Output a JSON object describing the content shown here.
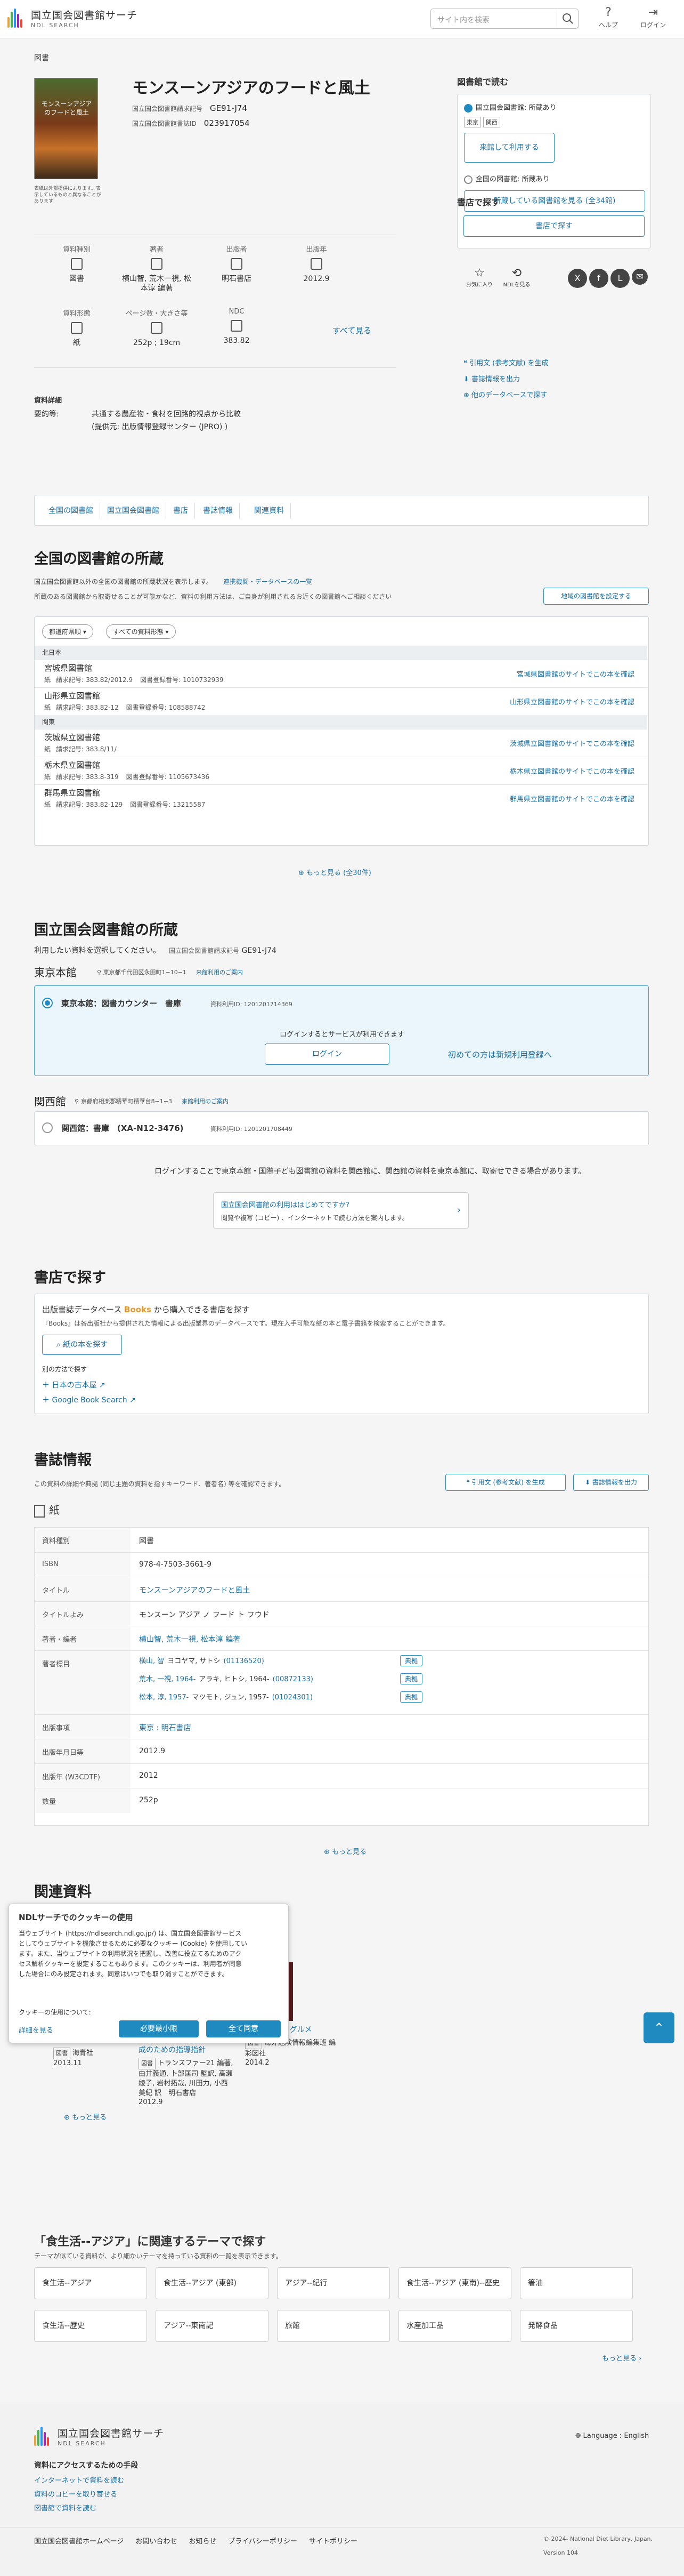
{
  "header": {
    "logo_title": "国立国会図書館サーチ",
    "logo_sub": "NDL SEARCH",
    "search_placeholder": "サイト内を検索",
    "help": "ヘルプ",
    "login": "ログイン"
  },
  "breadcrumb": "図書",
  "book": {
    "title": "モンスーンアジアのフードと風土",
    "cover_note": "表紙は外部提供によります。表示しているものと異なることがあります",
    "id_label1": "国立国会図書館請求記号",
    "id_val1": "GE91-J74",
    "id_label2": "国立国会図書館書誌ID",
    "id_val2": "023917054"
  },
  "facts": [
    {
      "label": "資料種別",
      "value": "図書",
      "icon": "book-icon"
    },
    {
      "label": "著者",
      "value": "横山智, 荒木一視, 松本淳 編著",
      "icon": "pen-icon"
    },
    {
      "label": "出版者",
      "value": "明石書店",
      "icon": "building-icon"
    },
    {
      "label": "出版年",
      "value": "2012.9",
      "icon": "calendar-icon"
    },
    {
      "label": "資料形態",
      "value": "紙",
      "icon": "paper-icon"
    },
    {
      "label": "ページ数・大きさ等",
      "value": "252p ; 19cm",
      "icon": "ruler-icon"
    },
    {
      "label": "NDC",
      "value": "383.82",
      "icon": "tree-icon"
    }
  ],
  "see_all": "すべて見る",
  "details": {
    "heading": "資料詳細",
    "summary_label": "要約等:",
    "summary": "共通する農産物・食材を回路的視点から比較",
    "summary2": "(提供元: 出版情報登録センター (JPRO) )"
  },
  "side": {
    "read_title": "図書館で読む",
    "ndl_label": "国立国会図書館: 所蔵あり",
    "tags": [
      "東京",
      "関西"
    ],
    "ndl_btn": "来館して利用する",
    "pref_label": "全国の図書館: 所蔵あり",
    "pref_btn": "所蔵している図書館を見る (全34館)",
    "buy_title": "書店で探す",
    "buy_btn": "書店で探す",
    "favorite": "お気に入り",
    "ndl_recommend": "NDLを見る",
    "cite": "引用文 (参考文献) を生成",
    "bib_out": "書誌情報を出力",
    "other_db": "他のデータベースで探す"
  },
  "tabs": [
    "全国の図書館",
    "国立国会図書館",
    "書店",
    "書誌情報",
    "関連資料"
  ],
  "national": {
    "title": "全国の図書館の所蔵",
    "desc": "国立国会図書館以外の全国の図書館の所蔵状況を表示します。",
    "desc_link": "連携機関・データベースの一覧",
    "note": "所蔵のある図書館から取寄せることが可能かなど、資料の利用方法は、ご自身が利用されるお近くの図書館へご相談ください",
    "set_btn": "地域の図書館を設定する",
    "filter1": "都道府県順",
    "filter2": "すべての資料形態",
    "libs": [
      {
        "region": "北日本",
        "name": "宮城県図書館",
        "call": "383.82/2012.9",
        "regno": "1010732939",
        "link": "宮城県図書館のサイトでこの本を確認"
      },
      {
        "region": "",
        "name": "山形県立図書館",
        "call": "383.82-12",
        "regno": "108588742",
        "link": "山形県立図書館のサイトでこの本を確認"
      },
      {
        "region": "関東",
        "name": "茨城県立図書館",
        "call": "383.8/11/",
        "regno": "",
        "link": "茨城県立図書館のサイトでこの本を確認"
      },
      {
        "region": "",
        "name": "栃木県立図書館",
        "call": "383.8-319",
        "regno": "1105673436",
        "link": "栃木県立図書館のサイトでこの本を確認"
      },
      {
        "region": "",
        "name": "群馬県立図書館",
        "call": "383.82-129",
        "regno": "13215587",
        "link": "群馬県立図書館のサイトでこの本を確認"
      }
    ],
    "call_label": "請求記号:",
    "regno_label": "図書登録番号:",
    "paper": "紙",
    "more": "もっと見る (全30件)"
  },
  "ndl": {
    "title": "国立国会図書館の所蔵",
    "desc": "利用したい資料を選択してください。",
    "callno_label": "国立国会図書館請求記号",
    "callno": "GE91-J74",
    "tokyo": "東京本館",
    "tokyo_addr": "東京都千代田区永田町1−10−1",
    "tokyo_guide": "来館利用のご案内",
    "tokyo_item": "東京本館：図書カウンター　書庫",
    "tokyo_itemid": "資料利用ID: 1201201714369",
    "login_msg": "ログインするとサービスが利用できます",
    "login_btn": "ログイン",
    "register": "初めての方は新規利用登録へ",
    "kansai": "関西館",
    "kansai_addr": "京都府相楽郡精華町精華台8−1−3",
    "kansai_guide": "来館利用のご案内",
    "kansai_item": "関西館：書庫　(XA-N12-3476)",
    "kansai_itemid": "資料利用ID: 1201201708449",
    "transfer_note": "ログインすることで東京本館・国際子ども図書館の資料を関西館に、関西館の資料を東京本館に、取寄せできる場合があります。",
    "help_title": "国立国会図書館の利用ははじめてですか?",
    "help_sub": "閲覧や複写 (コピー) 、インターネットで読む方法を案内します。"
  },
  "shop": {
    "title": "書店で探す",
    "db_prefix": "出版書誌データベース",
    "db_brand": "Books",
    "db_suffix": "から購入できる書店を探す",
    "db_note": "『Books』は各出版社から提供された情報による出版業界のデータベースです。現在入手可能な紙の本と電子書籍を検索することができます。",
    "btn": "紙の本を探す",
    "other": "別の方法で探す",
    "links": [
      "日本の古本屋",
      "Google Book Search"
    ]
  },
  "bib": {
    "title": "書誌情報",
    "desc": "この資料の詳細や典拠 (同じ主題の資料を指すキーワード、著者名) 等を確認できます。",
    "cite": "引用文 (参考文献) を生成",
    "out": "書誌情報を出力",
    "type": "紙",
    "rows": [
      {
        "k": "資料種別",
        "v": "図書"
      },
      {
        "k": "ISBN",
        "v": "978-4-7503-3661-9"
      },
      {
        "k": "タイトル",
        "v": "モンスーンアジアのフードと風土"
      },
      {
        "k": "タイトルよみ",
        "v": "モンスーン アジア ノ フード ト フウド"
      },
      {
        "k": "著者・編者",
        "v": "横山智, 荒木一視, 松本淳 編著"
      }
    ],
    "authority_label": "著者標目",
    "authors": [
      {
        "name": "横山, 智",
        "yomi": "ヨコヤマ, サトシ",
        "id": "01136520"
      },
      {
        "name": "荒木, 一視, 1964-",
        "yomi": "アラキ, ヒトシ, 1964-",
        "id": "00872133"
      },
      {
        "name": "松本, 淳, 1957-",
        "yomi": "マツモト, ジュン, 1957-",
        "id": "01024301"
      }
    ],
    "auth_btn": "典拠",
    "rows2": [
      {
        "k": "出版事項",
        "v": "東京 : 明石書店"
      },
      {
        "k": "出版年月日等",
        "v": "2012.9"
      },
      {
        "k": "出版年 (W3CDTF)",
        "v": "2012"
      },
      {
        "k": "数量",
        "v": "252p"
      }
    ],
    "more": "もっと見る"
  },
  "related": {
    "title": "関連資料",
    "items": [
      {
        "title": "ネイチャー・アンド・ソサエティ研究 第4巻",
        "pub": "海青社",
        "date": "2013.11",
        "tag": "図書"
      },
      {
        "title": "ESDコンピテンシー : 学校の質的向上と形成能力の育成のための指導指針",
        "pub": "トランスファー21 編著, 由井義通, 卜部匡司 監訳, 高瀬綾子, 岩村拓哉, 川田力, 小西美紀 訳　明石書店",
        "date": "2012.9",
        "tag": "図書"
      },
      {
        "title": "海外ブラックグルメ",
        "pub": "海外危険情報編集班 編　彩図社",
        "date": "2014.2",
        "tag": "図書"
      }
    ],
    "more": "もっと見る"
  },
  "cookie": {
    "title": "NDLサーチでのクッキーの使用",
    "body": "当ウェブサイト (https://ndlsearch.ndl.go.jp/) は、国立国会図書館サービスとしてウェブサイトを機能させるために必要なクッキー (Cookie) を使用しています。また、当ウェブサイトの利用状況を把握し、改善に役立てるためのアクセス解析クッキーを設定することもあります。このクッキーは、利用者が同意した場合にのみ設定されます。同意はいつでも取り消すことができます。",
    "q": "クッキーの使用について:",
    "detail": "詳細を見る",
    "reject": "必要最小限",
    "accept": "全て同意"
  },
  "themes": {
    "title": "「食生活--アジア」に関連するテーマで探す",
    "note": "テーマが似ている資料が、より細かいテーマを持っている資料の一覧を表示できます。",
    "items": [
      "食生活--アジア",
      "食生活--アジア (東部)",
      "アジア--紀行",
      "食生活--アジア (東南)--歴史",
      "箸油",
      "食生活--歴史",
      "アジア--東南記",
      "旅館",
      "水産加工品",
      "発酵食品"
    ],
    "more": "もっと見る"
  },
  "footer": {
    "logo_title": "国立国会図書館サーチ",
    "logo_sub": "NDL SEARCH",
    "lang": "Language : English",
    "access_title": "資料にアクセスするための手段",
    "links": [
      "インターネットで資料を読む",
      "資料のコピーを取り寄せる",
      "図書館で資料を読む"
    ],
    "bottom": [
      "国立国会図書館ホームページ",
      "お問い合わせ",
      "お知らせ",
      "プライバシーポリシー",
      "サイトポリシー"
    ],
    "copy": "© 2024- National Diet Library, Japan.",
    "version": "Version",
    "version_no": "104"
  }
}
